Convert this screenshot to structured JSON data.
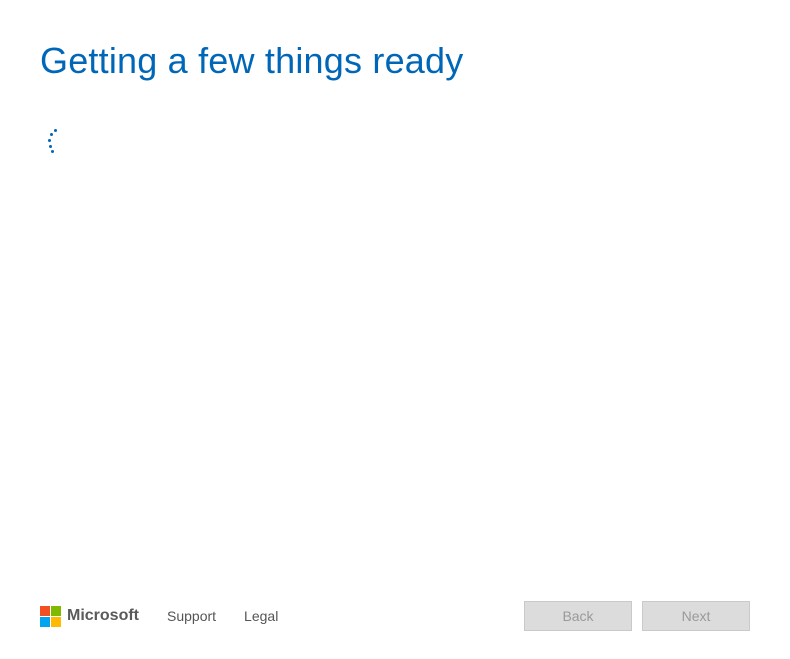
{
  "heading": "Getting a few things ready",
  "footer": {
    "brand": "Microsoft",
    "links": {
      "support": "Support",
      "legal": "Legal"
    },
    "buttons": {
      "back": "Back",
      "next": "Next"
    }
  },
  "logo_colors": {
    "tl": "#F25022",
    "tr": "#7FBA00",
    "bl": "#00A4EF",
    "br": "#FFB900"
  },
  "accent_color": "#0067B8"
}
